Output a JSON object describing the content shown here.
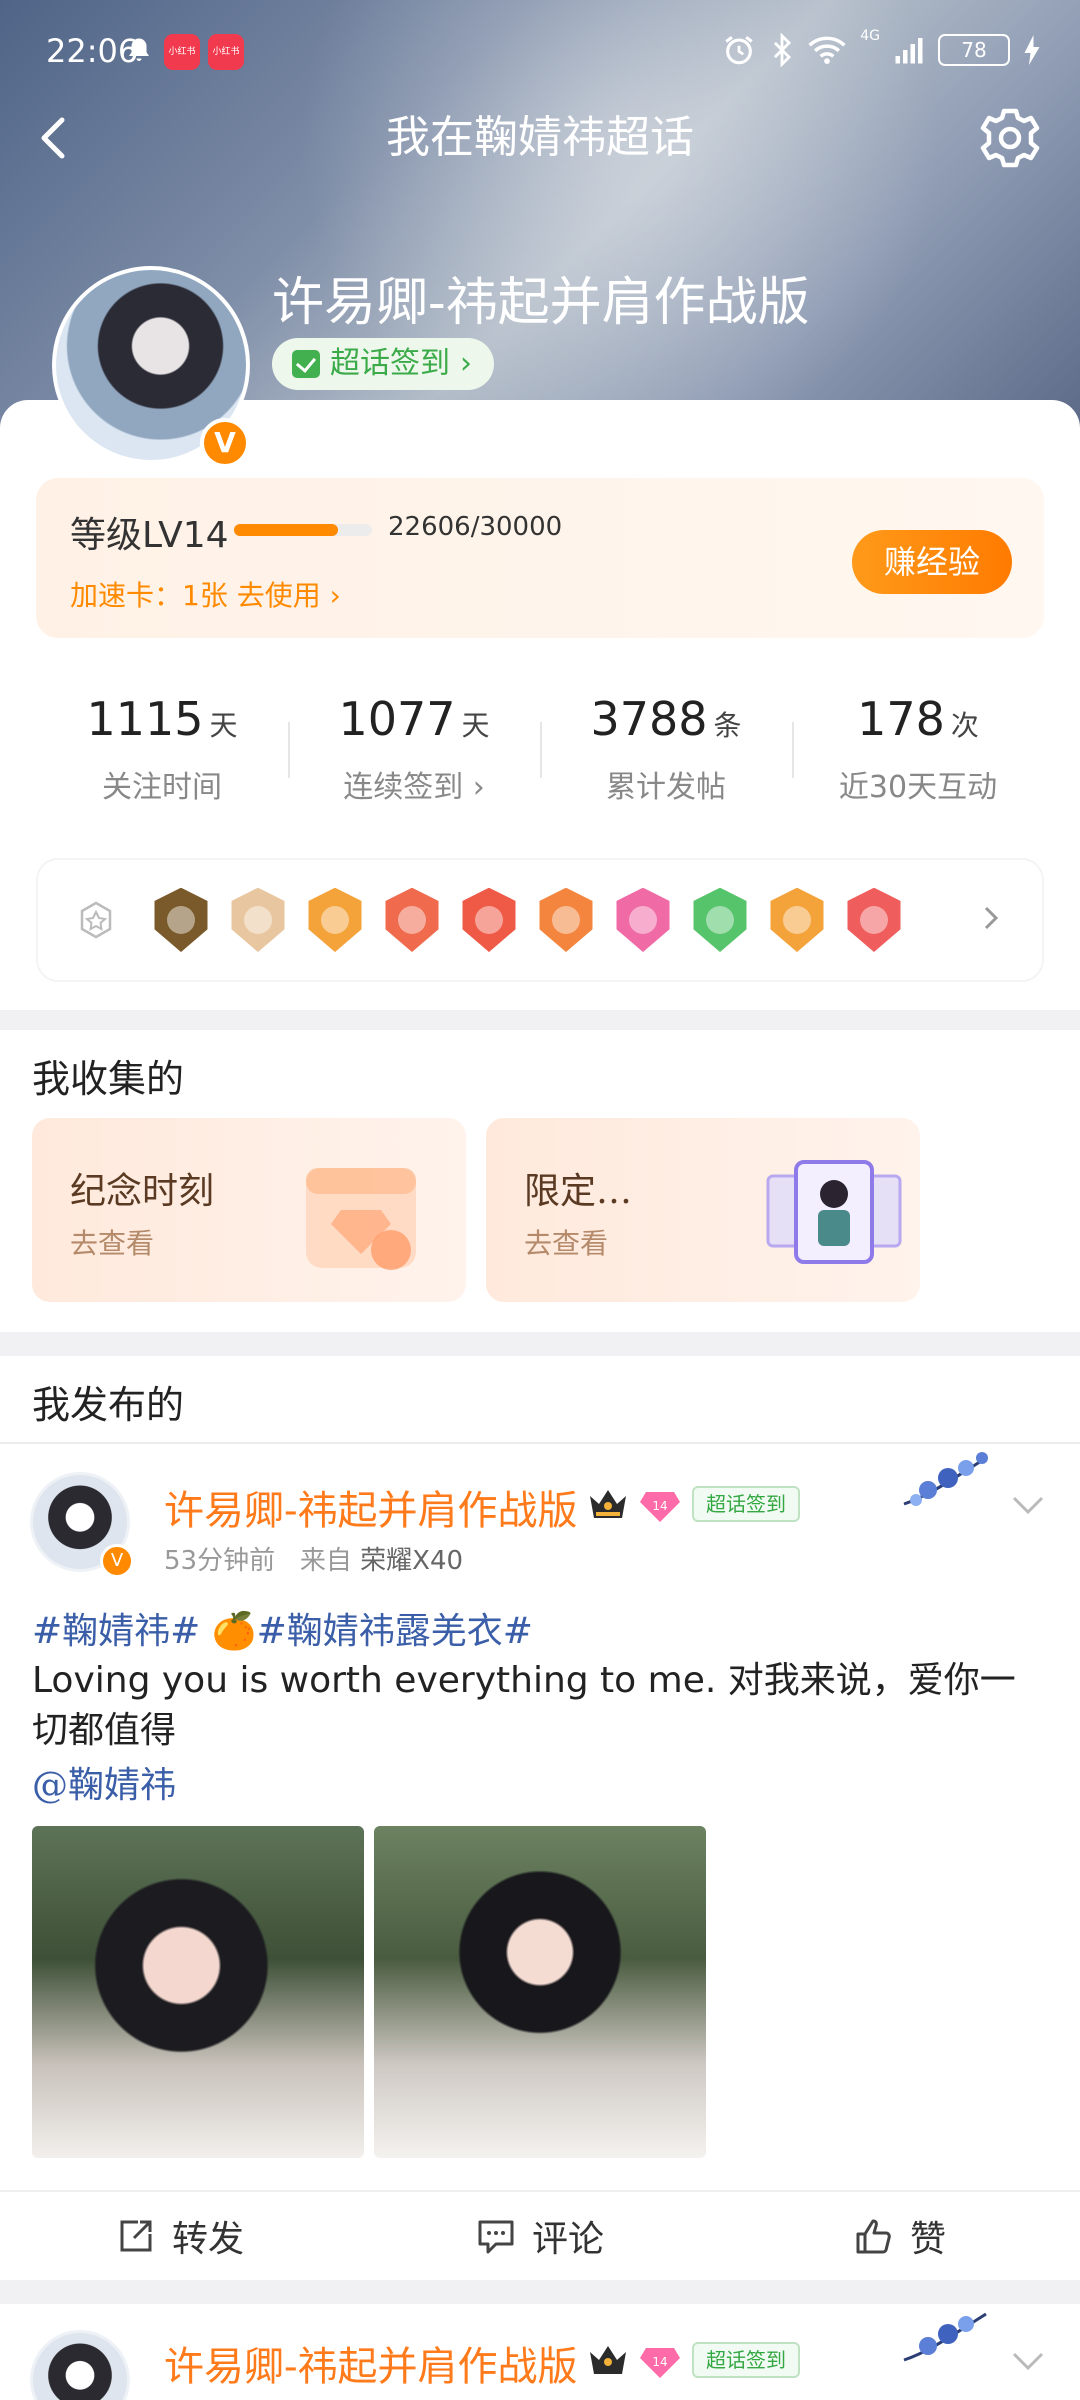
{
  "status_bar": {
    "time": "22:06",
    "app_badges": [
      "小红书",
      "小红书"
    ],
    "network": "4G",
    "battery": "78"
  },
  "nav": {
    "title": "我在鞠婧祎超话"
  },
  "profile": {
    "username": "许易卿-祎起并肩作战版",
    "checkin_label": "超话签到",
    "avatar_badge": "V"
  },
  "level": {
    "label": "等级LV14",
    "progress_text": "22606/30000",
    "progress_fraction": 0.7535,
    "speed_card_text": "加速卡：1张 去使用",
    "earn_button": "赚经验"
  },
  "stats": [
    {
      "value": "1115",
      "unit": "天",
      "label": "关注时间"
    },
    {
      "value": "1077",
      "unit": "天",
      "label": "连续签到 ›"
    },
    {
      "value": "3788",
      "unit": "条",
      "label": "累计发帖"
    },
    {
      "value": "178",
      "unit": "次",
      "label": "近30天互动"
    }
  ],
  "badges": {
    "colors": [
      "#7a5a2a",
      "#e8c7a0",
      "#f3a33a",
      "#f06b4e",
      "#ef5a47",
      "#f3853e",
      "#f06aa6",
      "#55c46a",
      "#f3a33a",
      "#ef5d5d"
    ]
  },
  "collection": {
    "title": "我收集的",
    "cards": [
      {
        "title": "纪念时刻",
        "sub": "去查看"
      },
      {
        "title": "限定…",
        "sub": "去查看"
      }
    ]
  },
  "posts_section": {
    "title": "我发布的"
  },
  "post": {
    "author": "许易卿-祎起并肩作战版",
    "vip_level": "14",
    "checkin_label": "超话签到",
    "time": "53分钟前",
    "source_prefix": "来自",
    "device": "荣耀X40",
    "tags": "#鞠婧祎# 🍊#鞠婧祎露羌衣#",
    "text": " Loving you is worth everything to me. 对我来说，爱你一切都值得",
    "mention": "@鞠婧祎",
    "actions": {
      "repost": "转发",
      "comment": "评论",
      "like": "赞"
    }
  },
  "post2": {
    "author": "许易卿-祎起并肩作战版",
    "vip_level": "14",
    "checkin_label": "超话签到"
  }
}
